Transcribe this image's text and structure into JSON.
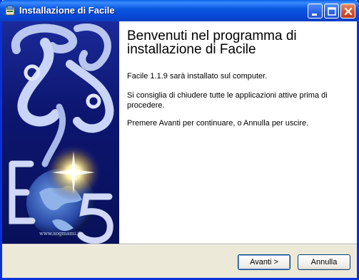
{
  "window": {
    "title": "Installazione di Facile"
  },
  "titlebar_buttons": {
    "minimize": "minimize-icon",
    "maximize": "maximize-icon",
    "close": "close-icon"
  },
  "sidebar": {
    "watermark": "www.sogmami.it"
  },
  "content": {
    "heading_line1": "Benvenuti nel programma di",
    "heading_line2": "installazione di Facile",
    "paragraph1": "Facile 1.1.9 sarà installato sul computer.",
    "paragraph2_line1": "Si consiglia di chiudere tutte le applicazioni attive prima di",
    "paragraph2_line2": "procedere.",
    "paragraph3": "Premere Avanti per continuare, o Annulla per uscire."
  },
  "buttons": {
    "next": "Avanti >",
    "cancel": "Annulla"
  },
  "colors": {
    "titlebar": "#0b58e0",
    "sidebar": "#0d1670",
    "close": "#d2532f",
    "face": "#ece9d8"
  }
}
